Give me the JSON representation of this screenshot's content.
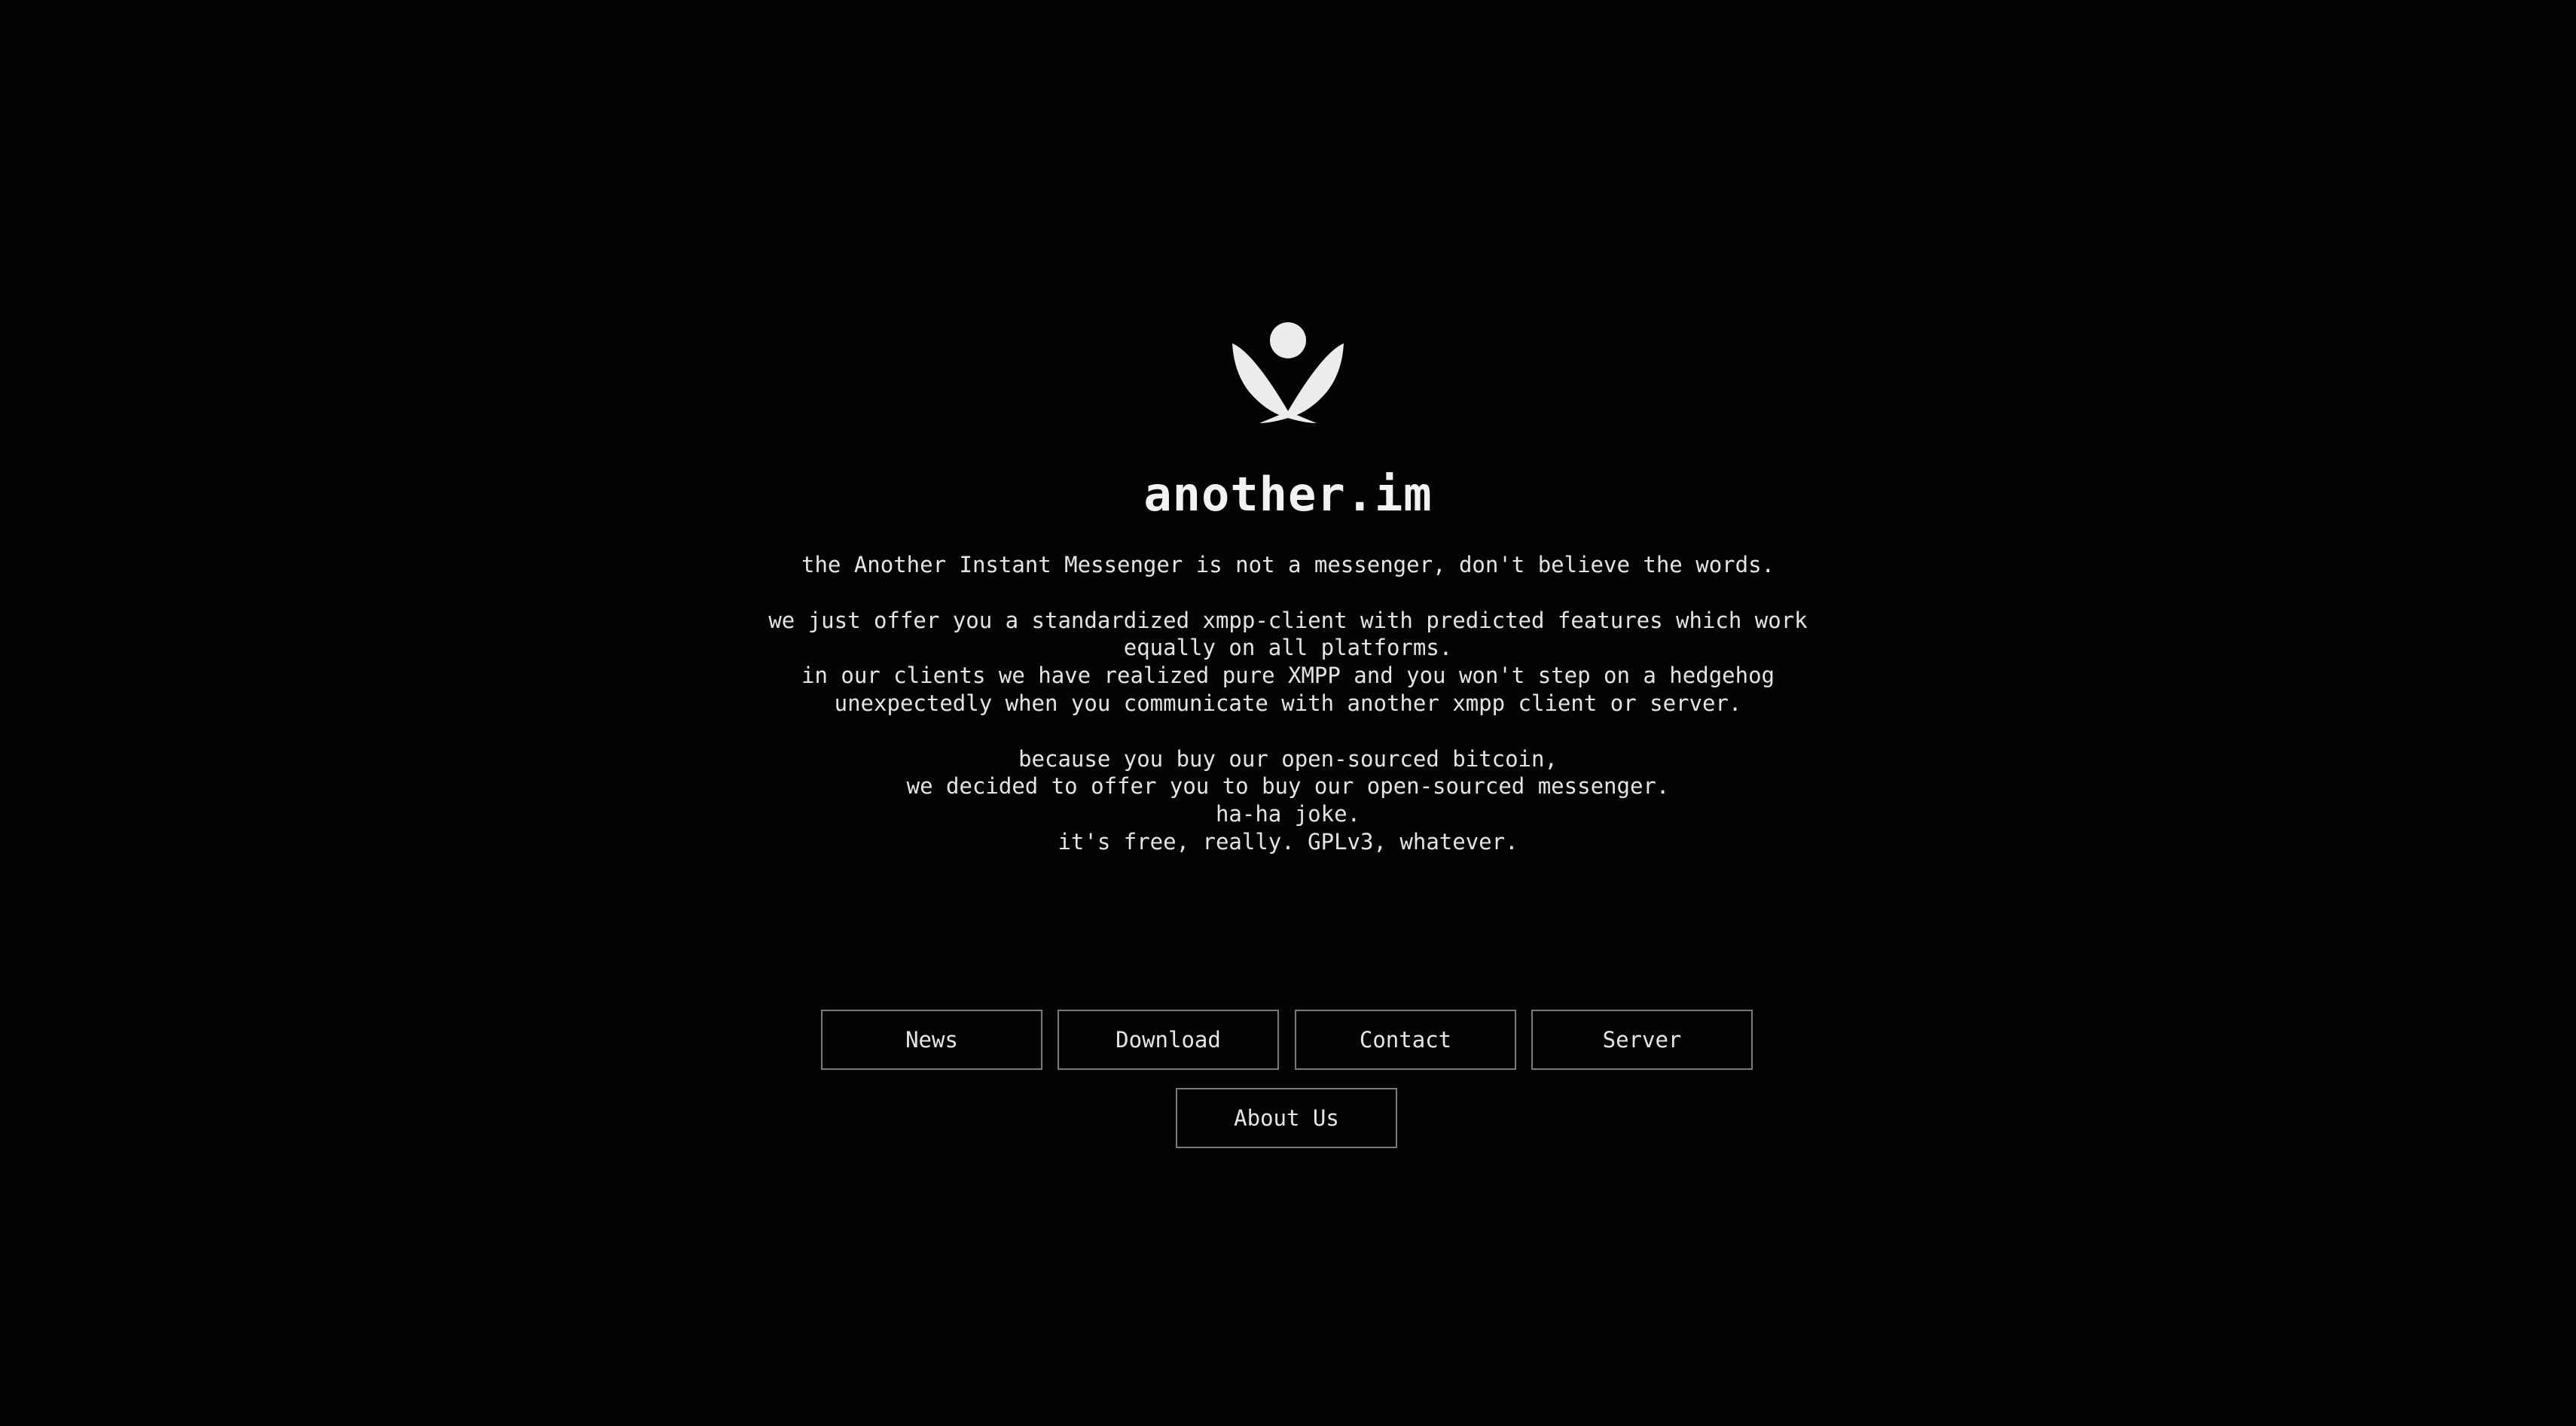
{
  "site": {
    "logo_icon": "another-im-logo-icon",
    "title": "another.im"
  },
  "description": {
    "tagline": "the Another Instant Messenger is not a messenger, don't believe the words.",
    "para2_line1": "we just offer you a standardized xmpp-client with predicted features which work",
    "para2_line2": "equally on all platforms.",
    "para2_line3": "in our clients we have realized pure XMPP and you won't step on a hedgehog",
    "para2_line4": "unexpectedly when you communicate with another xmpp client or server.",
    "para3_line1": "because you buy our open-sourced bitcoin,",
    "para3_line2": "we decided to offer you to buy our open-sourced messenger.",
    "para3_line3": "ha-ha joke.",
    "para3_line4": "it's free, really. GPLv3, whatever."
  },
  "nav": {
    "news": "News",
    "download": "Download",
    "contact": "Contact",
    "server": "Server",
    "about_us": "About Us"
  },
  "colors": {
    "background": "#040404",
    "text": "#f0f0f0",
    "button_border": "#7a7a7a"
  }
}
